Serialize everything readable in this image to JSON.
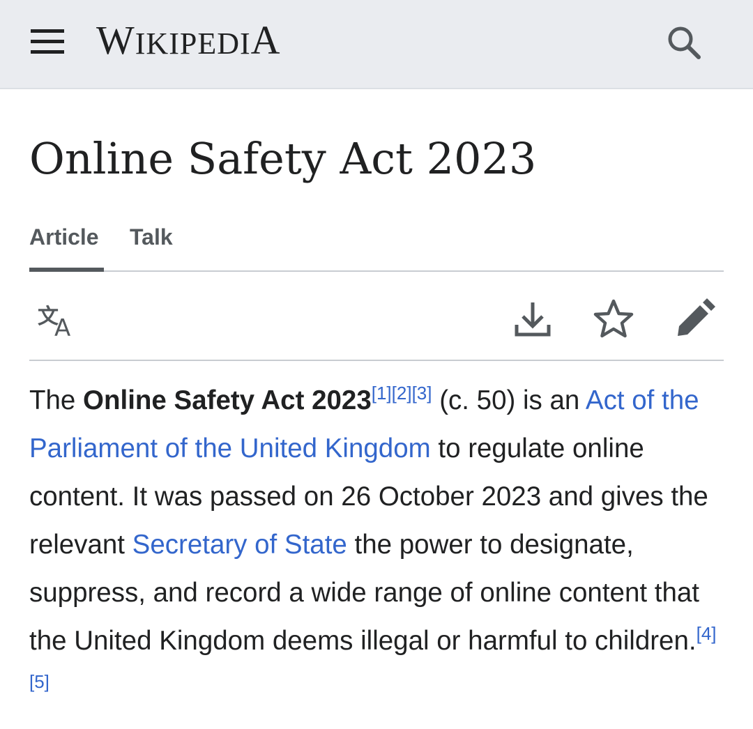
{
  "header": {
    "logo_text": "WIKIPEDIA",
    "menu_icon": "hamburger-menu-icon",
    "search_icon": "search-icon"
  },
  "page": {
    "title": "Online Safety Act 2023"
  },
  "tabs": [
    {
      "label": "Article",
      "selected": true
    },
    {
      "label": "Talk",
      "selected": false
    }
  ],
  "toolbar": {
    "language_icon": "translate-icon",
    "download_icon": "download-icon",
    "watch_icon": "star-icon",
    "edit_icon": "pencil-icon"
  },
  "lead": {
    "t1": "The ",
    "bold_title": "Online Safety Act 2023",
    "ref1": "[1]",
    "ref2": "[2]",
    "ref3": "[3]",
    "t2": " (c. 50) is an ",
    "link1": "Act of the Parliament of the United Kingdom",
    "t3": " to regulate online content. It was passed on 26 October 2023 and gives the relevant ",
    "link2": "Secretary of State",
    "t4": " the power to designate, suppress, and record a wide range of online content that the United Kingdom deems illegal or harmful to children.",
    "ref4": "[4]",
    "ref5": "[5]"
  },
  "colors": {
    "header_bg": "#eaecf0",
    "link": "#3366cc",
    "text": "#202122",
    "tab": "#54595d",
    "divider": "#c8ccd1"
  }
}
